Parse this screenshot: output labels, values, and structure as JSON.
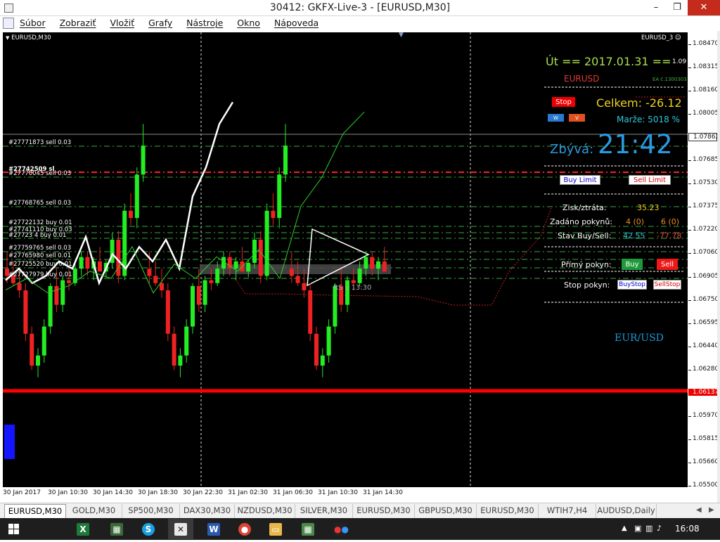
{
  "window": {
    "title": "30412: GKFX-Live-3 - [EURUSD,M30]",
    "min": "–",
    "max": "❐",
    "close": "✕"
  },
  "menu": [
    "Súbor",
    "Zobraziť",
    "Vložiť",
    "Grafy",
    "Nástroje",
    "Okno",
    "Nápoveda"
  ],
  "mdi": {
    "min": "_",
    "restore": "❐",
    "close": "✕"
  },
  "chart": {
    "symbol_label": "EURUSD,M30",
    "ea_label": "EURUSD_3",
    "price_ticks": [
      "1.08470",
      "1.08315",
      "1.08160",
      "1.08005",
      "1.07862",
      "1.07685",
      "1.07530",
      "1.07375",
      "1.07220",
      "1.07060",
      "1.06905",
      "1.06750",
      "1.06595",
      "1.06440",
      "1.06280",
      "1.06137",
      "1.05970",
      "1.05815",
      "1.05660",
      "1.05500"
    ],
    "current_price": "1.07862",
    "support_price": "1.06137",
    "time_ticks": [
      "30 Jan 2017",
      "30 Jan 10:30",
      "30 Jan 14:30",
      "30 Jan 18:30",
      "30 Jan 22:30",
      "31 Jan 02:30",
      "31 Jan 06:30",
      "31 Jan 10:30",
      "31 Jan 14:30"
    ],
    "pattern_label": "RS v 13:30",
    "orders": [
      "#27771873 sell 0.03",
      "#27742509 sl",
      "#27770045 sell 0.03",
      "#27768765 sell 0.03",
      "#27722132 buy 0.01",
      "#27741110 buy 0.03",
      "#27723 4 buy 0.01",
      "#27759765 sell 0.03",
      "#27765980 sell 0.01",
      "#27725520 buy 0.01",
      "#27727979 buy 0.01"
    ],
    "colors": {
      "bull": "#22ee22",
      "bear": "#ee2222",
      "overlay": "#ffffff",
      "signal": "#2ad02a"
    }
  },
  "chart_data": {
    "type": "candlestick",
    "x": [
      "30 Jan 2017",
      "30 Jan 10:30",
      "30 Jan 14:30",
      "30 Jan 18:30",
      "30 Jan 22:30",
      "31 Jan 02:30",
      "31 Jan 06:30",
      "31 Jan 10:30",
      "31 Jan 14:30"
    ],
    "ylim": [
      1.055,
      1.0855
    ],
    "ohlc": [
      [
        1.07,
        1.0712,
        1.069,
        1.0695
      ],
      [
        1.0695,
        1.0705,
        1.0688,
        1.069
      ],
      [
        1.069,
        1.07,
        1.068,
        1.0685
      ],
      [
        1.0685,
        1.069,
        1.065,
        1.0655
      ],
      [
        1.0655,
        1.066,
        1.063,
        1.0633
      ],
      [
        1.0633,
        1.0645,
        1.0625,
        1.064
      ],
      [
        1.064,
        1.0665,
        1.0635,
        1.066
      ],
      [
        1.066,
        1.069,
        1.0655,
        1.0688
      ],
      [
        1.0688,
        1.07,
        1.067,
        1.0675
      ],
      [
        1.0675,
        1.0695,
        1.067,
        1.0692
      ],
      [
        1.0692,
        1.07,
        1.0685,
        1.069
      ],
      [
        1.069,
        1.0705,
        1.0688,
        1.07
      ],
      [
        1.07,
        1.0712,
        1.0695,
        1.0708
      ],
      [
        1.0708,
        1.0712,
        1.0695,
        1.07
      ],
      [
        1.07,
        1.0708,
        1.0692,
        1.0705
      ],
      [
        1.0705,
        1.0715,
        1.07,
        1.0698
      ],
      [
        1.0698,
        1.0706,
        1.0694,
        1.0704
      ],
      [
        1.0704,
        1.0725,
        1.07,
        1.072
      ],
      [
        1.072,
        1.0726,
        1.069,
        1.0695
      ],
      [
        1.0695,
        1.0745,
        1.0692,
        1.074
      ],
      [
        1.074,
        1.0752,
        1.073,
        1.0735
      ],
      [
        1.0735,
        1.077,
        1.0728,
        1.0765
      ],
      [
        1.0765,
        1.08,
        1.076,
        1.0785
      ]
    ],
    "overlay_line": [
      1.0692,
      1.07,
      1.069,
      1.0695,
      1.0705,
      1.07,
      1.0722,
      1.069,
      1.071,
      1.07,
      1.0715,
      1.0705,
      1.072,
      1.07,
      1.075,
      1.077,
      1.08,
      1.0815
    ]
  },
  "panel": {
    "date": "Út  ==  2017.01.31  ==",
    "version": "1.09",
    "symbol": "EURUSD",
    "ea_id": "EA č.1300303",
    "stop": "Stop",
    "total_label": "Celkem: -26.12",
    "btn_up": "W",
    "btn_v": "V",
    "margin": "Marže:  5018 %",
    "remaining_label": "Zbývá:",
    "remaining_time": "21:42",
    "buy_limit": "Buy Limit",
    "sell_limit": "Sell Limit",
    "pl_label": "Zisk/ztráta:",
    "pl_value": "35.23",
    "placed_label": "Zadáno pokynů:",
    "placed_buy": "4 (0)",
    "placed_sell": "6 (0)",
    "state_label": "Stav Buy/Sell:",
    "state_buy": "42.55",
    "state_sell": "-77.78",
    "direct_label": "Přímý pokyn:",
    "buy": "Buy",
    "sell": "Sell",
    "stop_label": "Stop pokyn:",
    "buy_stop": "BuyStop",
    "sell_stop": "SellStop",
    "pair": "EUR/USD"
  },
  "tabs": [
    "EURUSD,M30",
    "GOLD,M30",
    "SP500,M30",
    "DAX30,M30",
    "NZDUSD,M30",
    "SILVER,M30",
    "EURUSD,M30",
    "GBPUSD,M30",
    "EURUSD,M30",
    "WTIH7,H4",
    "AUDUSD,Daily"
  ],
  "taskbar": {
    "clock": "16:08"
  }
}
